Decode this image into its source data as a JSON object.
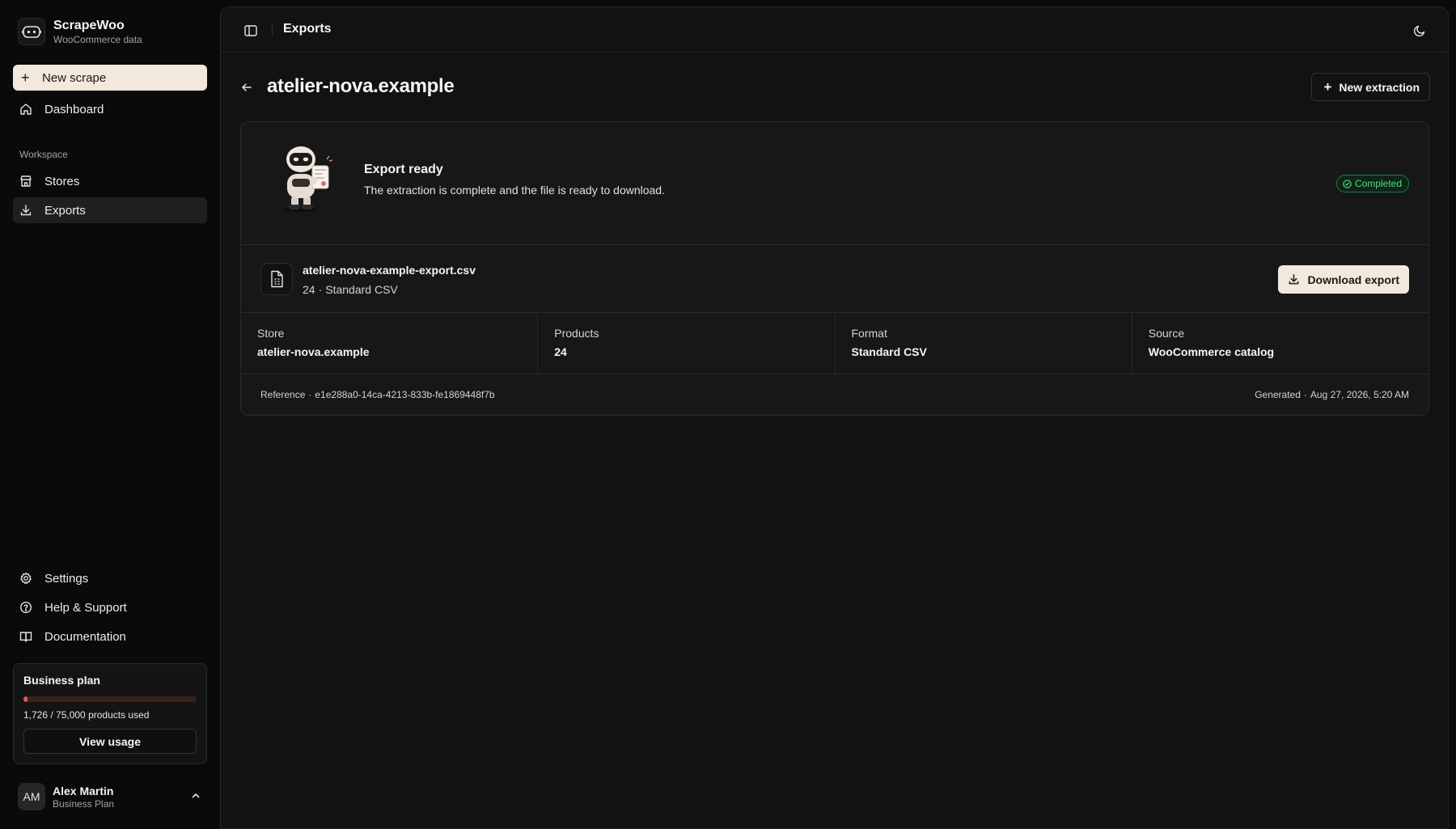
{
  "brand": {
    "name": "ScrapeWoo",
    "subtitle": "WooCommerce data",
    "logo_icon": "robot-icon"
  },
  "sidebar": {
    "new_scrape_label": "New scrape",
    "dashboard_label": "Dashboard",
    "section_label": "Workspace",
    "items": [
      {
        "label": "Stores",
        "icon": "store-icon"
      },
      {
        "label": "Exports",
        "icon": "download-icon",
        "active": true
      }
    ],
    "bottom_items": [
      {
        "label": "Settings",
        "icon": "gear-icon"
      },
      {
        "label": "Help & Support",
        "icon": "help-icon"
      },
      {
        "label": "Documentation",
        "icon": "book-icon"
      }
    ]
  },
  "plan": {
    "title": "Business plan",
    "used_text": "1,726 / 75,000 products used",
    "usage_fraction": 0.023,
    "button_label": "View usage",
    "bar_color": "#e05a5a"
  },
  "user": {
    "initials": "AM",
    "name": "Alex Martin",
    "plan": "Business Plan"
  },
  "topbar": {
    "title": "Exports"
  },
  "page": {
    "title": "atelier-nova.example",
    "new_extraction_label": "New extraction"
  },
  "export": {
    "hero_title": "Export ready",
    "hero_description": "The extraction is complete and the file is ready to download.",
    "status": "Completed",
    "status_color": "#4ade80",
    "file_name": "atelier-nova-example-export.csv",
    "file_count": "24",
    "file_separator": "·",
    "file_format": "Standard CSV",
    "download_label": "Download export",
    "stats": [
      {
        "label": "Store",
        "value": "atelier-nova.example"
      },
      {
        "label": "Products",
        "value": "24"
      },
      {
        "label": "Format",
        "value": "Standard CSV"
      },
      {
        "label": "Source",
        "value": "WooCommerce catalog"
      }
    ],
    "reference_label": "Reference",
    "reference_value": "e1e288a0-14ca-4213-833b-fe1869448f7b",
    "generated_label": "Generated",
    "generated_value": "Aug 27, 2026, 5:20 AM"
  },
  "colors": {
    "accent": "#f2e8dc",
    "background": "#0a0a0a",
    "panel": "#171717"
  }
}
